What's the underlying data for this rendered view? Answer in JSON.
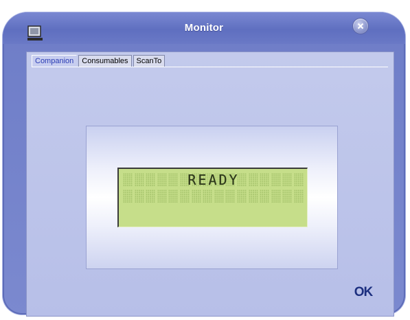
{
  "window": {
    "title": "Monitor",
    "app_icon": "computer-monitor-icon",
    "close_icon": "close-icon"
  },
  "tabs": [
    {
      "label": "Companion",
      "active": true
    },
    {
      "label": "Consumables",
      "active": false
    },
    {
      "label": "ScanTo",
      "active": false
    }
  ],
  "lcd": {
    "line1": "READY",
    "line2": ""
  },
  "actions": {
    "ok_label": "OK"
  },
  "colors": {
    "accent": "#5f6fc0",
    "active_tab_text": "#2a3cb4",
    "lcd_background": "#c6de8a",
    "ok_text": "#1c2f7f"
  }
}
